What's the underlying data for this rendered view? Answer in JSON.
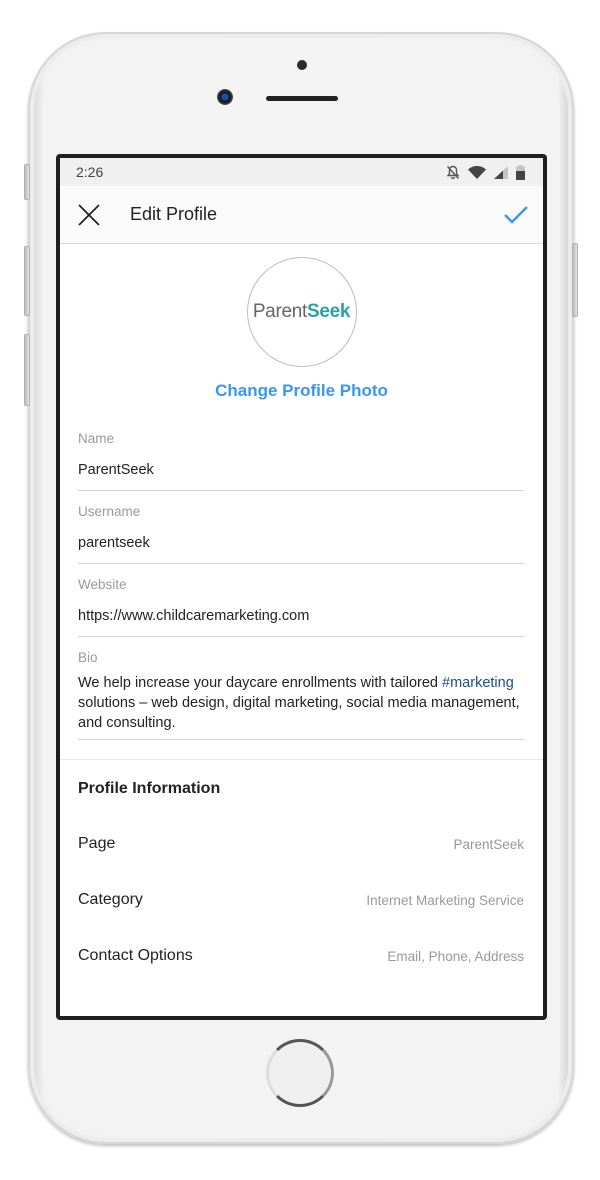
{
  "status_bar": {
    "time": "2:26",
    "icons": [
      "notifications-off-icon",
      "wifi-icon",
      "cell-signal-icon",
      "battery-icon"
    ]
  },
  "app_bar": {
    "close_icon": "close-icon",
    "title": "Edit Profile",
    "confirm_icon": "check-icon"
  },
  "profile_photo": {
    "logo_part1": "Parent",
    "logo_part2": "Seek",
    "change_label": "Change Profile Photo"
  },
  "fields": {
    "name": {
      "label": "Name",
      "value": "ParentSeek"
    },
    "username": {
      "label": "Username",
      "value": "parentseek"
    },
    "website": {
      "label": "Website",
      "value": "https://www.childcaremarketing.com"
    },
    "bio": {
      "label": "Bio",
      "text_before": "We help increase your daycare enrollments with tailored ",
      "hashtag": "#marketing",
      "text_after": " solutions – web design, digital marketing, social media management, and consulting."
    }
  },
  "profile_information": {
    "title": "Profile Information",
    "rows": [
      {
        "label": "Page",
        "value": "ParentSeek"
      },
      {
        "label": "Category",
        "value": "Internet Marketing Service"
      },
      {
        "label": "Contact Options",
        "value": "Email, Phone, Address"
      }
    ]
  },
  "colors": {
    "accent": "#3897f0",
    "hashtag": "#1e4d8c",
    "logo_teal": "#2aa1a8"
  }
}
